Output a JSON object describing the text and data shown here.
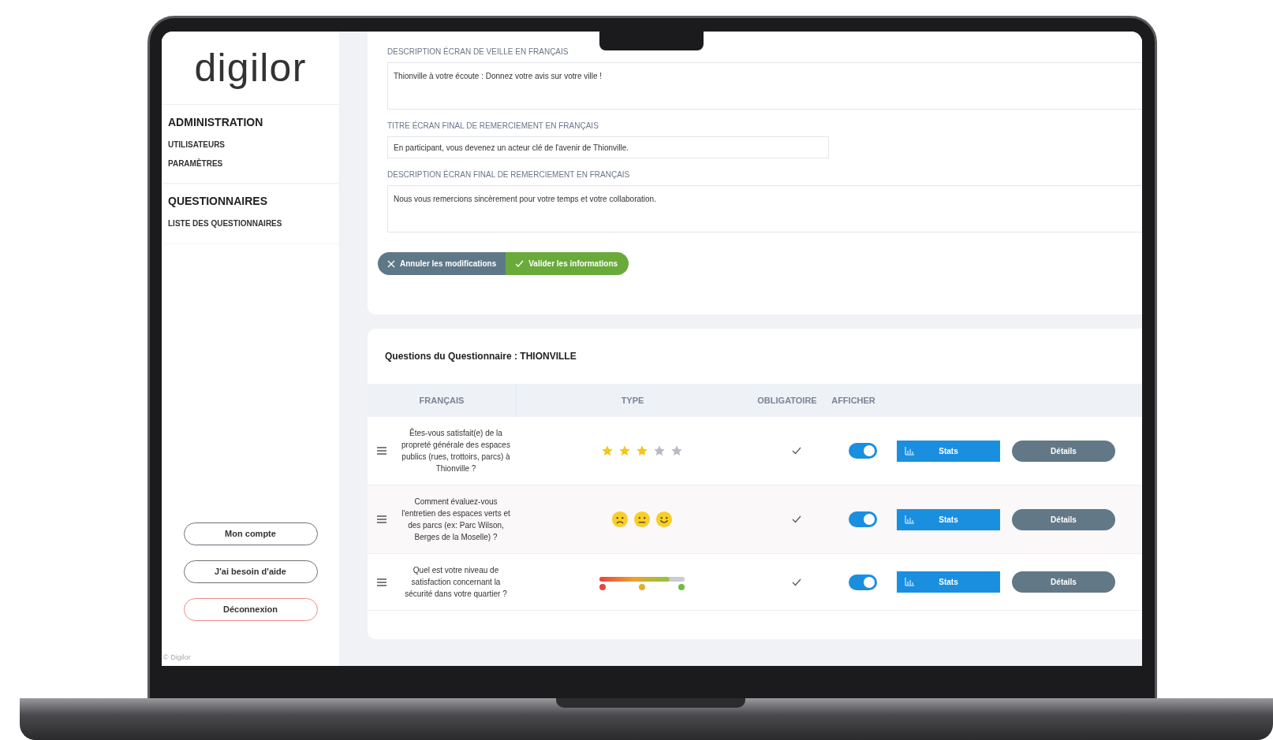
{
  "sidebar": {
    "logo": "digilor",
    "sections": [
      {
        "title": "ADMINISTRATION",
        "items": [
          "UTILISATEURS",
          "PARAMÈTRES"
        ]
      },
      {
        "title": "QUESTIONNAIRES",
        "items": [
          "LISTE DES QUESTIONNAIRES"
        ]
      }
    ],
    "buttons": [
      {
        "label": "Mon compte",
        "kind": "normal"
      },
      {
        "label": "J'ai besoin d'aide",
        "kind": "normal"
      },
      {
        "label": "Déconnexion",
        "kind": "danger"
      }
    ],
    "footer": "© Digilor"
  },
  "form": {
    "fields": [
      {
        "label": "DESCRIPTION ÉCRAN DE VEILLE EN FRANÇAIS",
        "value": "Thionville à votre écoute : Donnez votre avis sur votre ville !",
        "kind": "textarea"
      },
      {
        "label": "TITRE ÉCRAN FINAL DE REMERCIEMENT EN FRANÇAIS",
        "value": "En participant, vous devenez un acteur clé de l'avenir de Thionville.",
        "kind": "input"
      },
      {
        "label": "DESCRIPTION ÉCRAN FINAL DE REMERCIEMENT EN FRANÇAIS",
        "value": "Nous vous remercions sincèrement pour votre temps et votre collaboration.",
        "kind": "textarea"
      }
    ],
    "cancel": "Annuler les modifications",
    "submit": "Valider les informations"
  },
  "questions": {
    "title": "Questions du Questionnaire : THIONVILLE",
    "columns": [
      "FRANÇAIS",
      "TYPE",
      "OBLIGATOIRE",
      "AFFICHER"
    ],
    "rows": [
      {
        "text": "Êtes-vous satisfait(e) de la propreté générale des espaces publics (rues, trottoirs, parcs) à Thionville ?",
        "kind": "stars",
        "stars": 3,
        "required": true,
        "shown": true,
        "stats": "Stats",
        "details": "Détails"
      },
      {
        "text": "Comment évaluez-vous l'entretien des espaces verts et des parcs (ex: Parc Wilson, Berges de la Moselle) ?",
        "kind": "smileys",
        "required": true,
        "shown": true,
        "stats": "Stats",
        "details": "Détails"
      },
      {
        "text": "Quel est votre niveau de satisfaction concernant la sécurité dans votre quartier ?",
        "kind": "slider",
        "level": 0.82,
        "required": true,
        "shown": true,
        "stats": "Stats",
        "details": "Détails"
      }
    ]
  }
}
